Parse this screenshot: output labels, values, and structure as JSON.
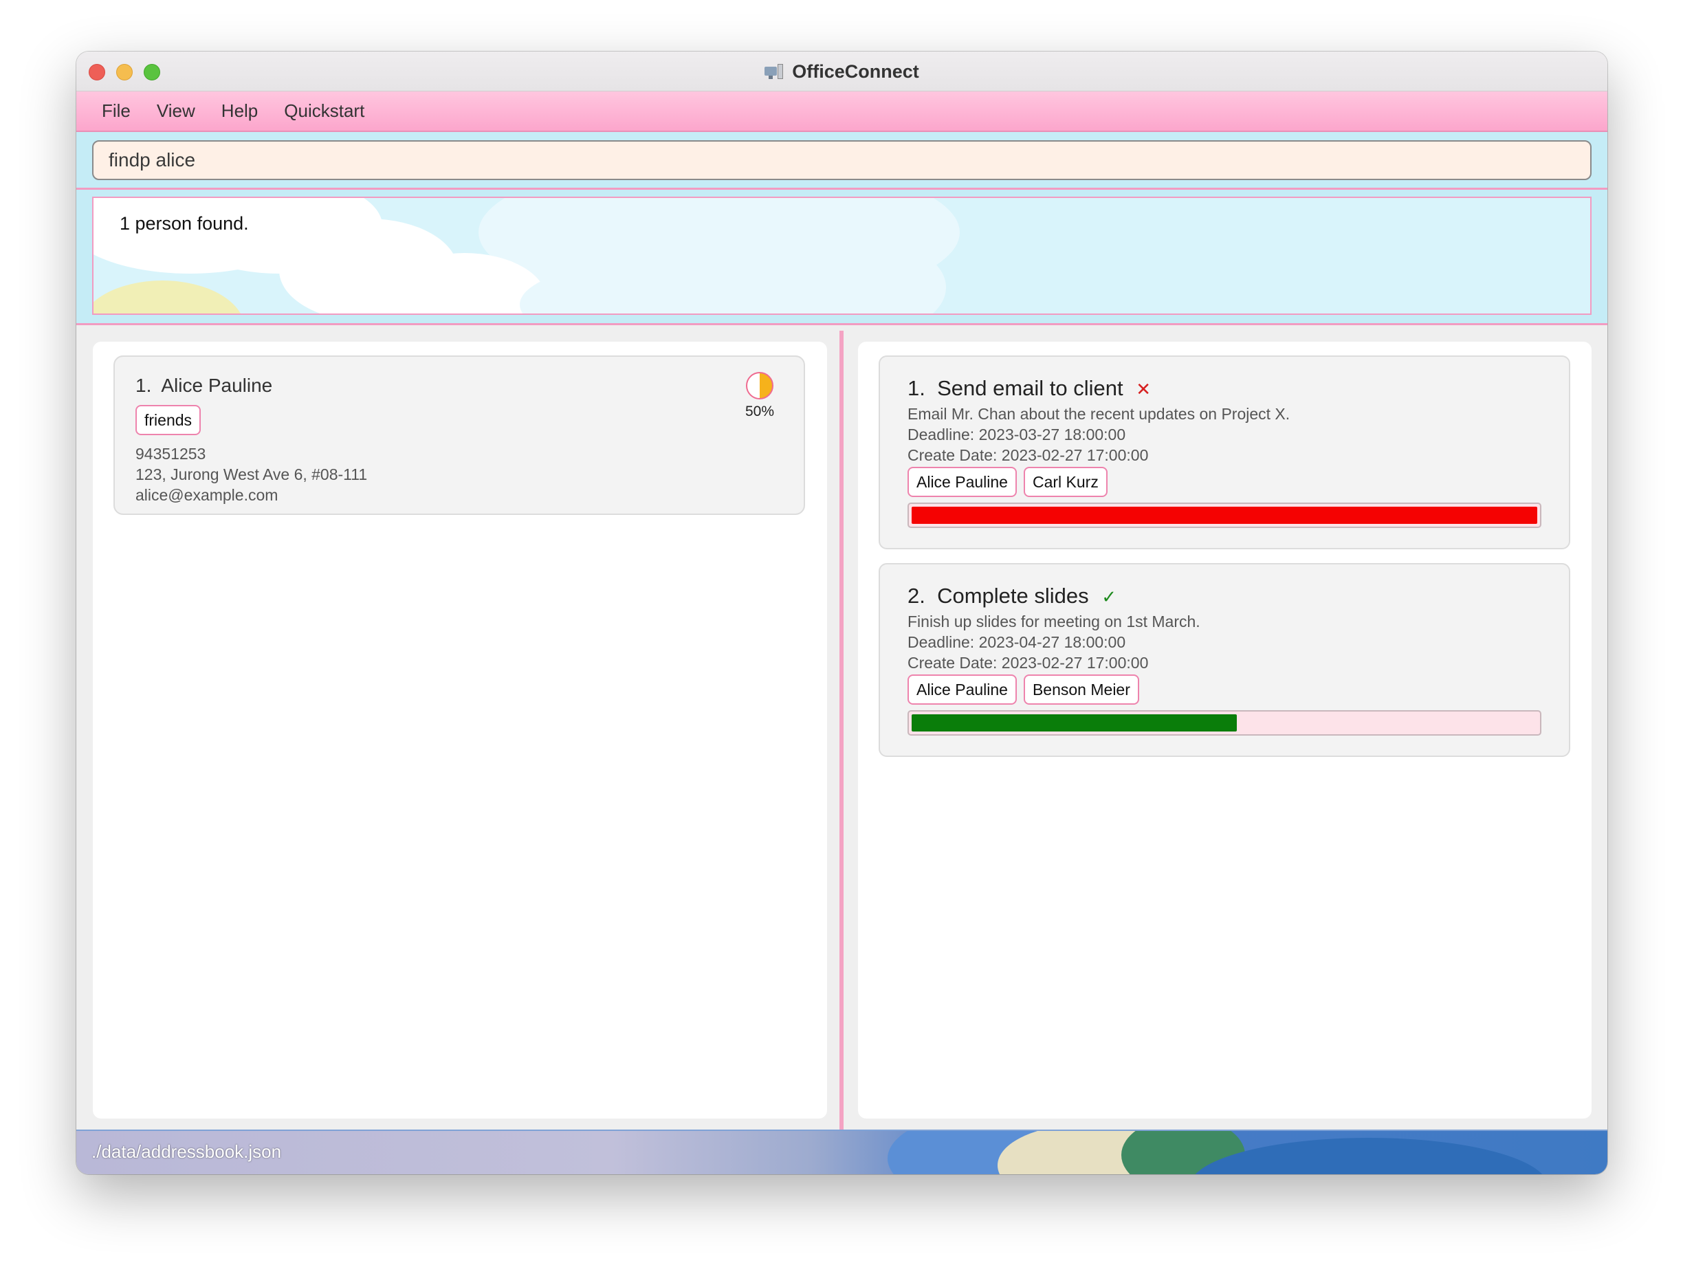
{
  "window": {
    "title": "OfficeConnect",
    "app_icon": "computer-icon"
  },
  "menu": {
    "items": [
      "File",
      "View",
      "Help",
      "Quickstart"
    ]
  },
  "command": {
    "value": "findp alice"
  },
  "result": {
    "message": "1 person found."
  },
  "persons": [
    {
      "index": "1.",
      "name": "Alice Pauline",
      "tags": [
        "friends"
      ],
      "phone": "94351253",
      "address": "123, Jurong West Ave 6, #08-111",
      "email": "alice@example.com",
      "progress_label": "50%",
      "progress_fraction": 0.5
    }
  ],
  "tasks": [
    {
      "index": "1.",
      "title": "Send email to client",
      "status": "incomplete",
      "status_mark": "✕",
      "description": "Email Mr. Chan about the recent updates on Project X.",
      "deadline": "Deadline: 2023-03-27 18:00:00",
      "create_date": "Create Date: 2023-02-27 17:00:00",
      "assignees": [
        "Alice Pauline",
        "Carl Kurz"
      ],
      "progress_fraction": 1.0,
      "progress_color": "#f50202"
    },
    {
      "index": "2.",
      "title": "Complete slides",
      "status": "done",
      "status_mark": "✓",
      "description": "Finish up slides for meeting on 1st March.",
      "deadline": "Deadline: 2023-04-27 18:00:00",
      "create_date": "Create Date: 2023-02-27 17:00:00",
      "assignees": [
        "Alice Pauline",
        "Benson Meier"
      ],
      "progress_fraction": 0.52,
      "progress_color": "#0a7d0a"
    }
  ],
  "statusbar": {
    "path": "./data/addressbook.json"
  },
  "colors": {
    "menu_bar": "#fdb4d4",
    "command_bg": "#c5ecf6",
    "input_bg": "#fef0e6",
    "tag_border": "#ee83ad",
    "divider": "#f4a3c3"
  }
}
